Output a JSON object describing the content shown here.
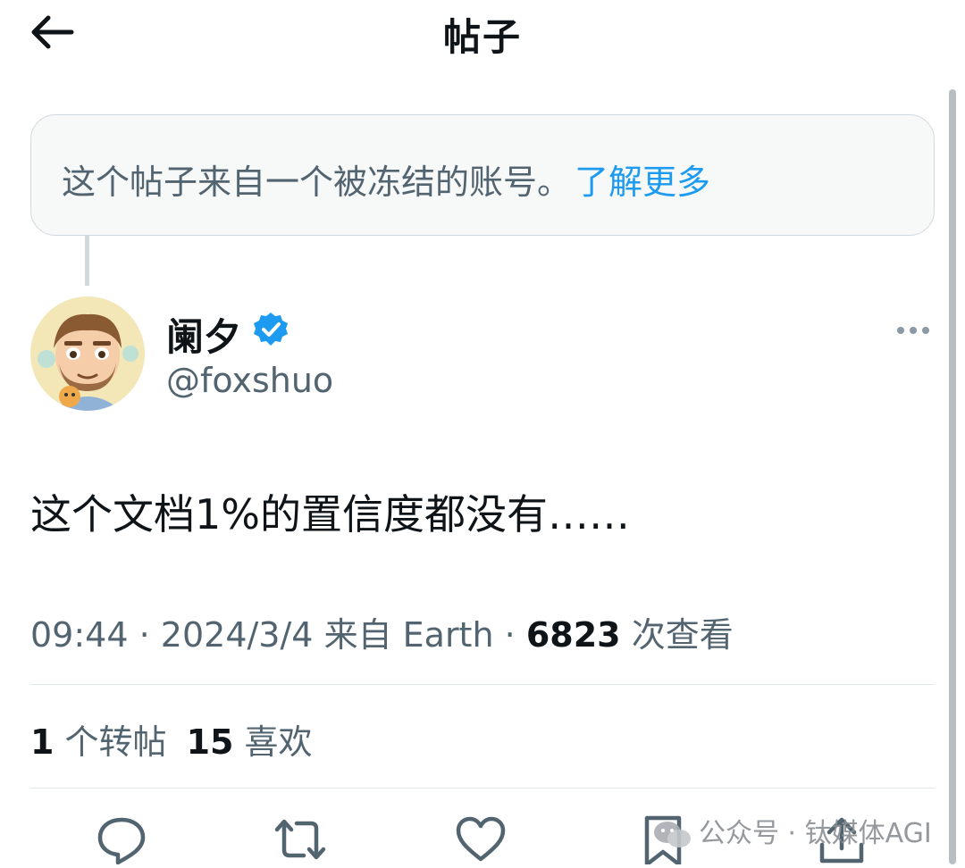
{
  "header": {
    "title": "帖子"
  },
  "notice": {
    "text": "这个帖子来自一个被冻结的账号。",
    "link": "了解更多"
  },
  "author": {
    "name": "阑夕",
    "handle": "@foxshuo",
    "verified": true
  },
  "post": {
    "text": "这个文档1%的置信度都没有……",
    "time": "09:44",
    "date": "2024/3/4",
    "source": "来自 Earth",
    "views": "6823",
    "views_label": "次查看"
  },
  "stats": {
    "reposts": "1",
    "reposts_label": "个转帖",
    "likes": "15",
    "likes_label": "喜欢"
  },
  "actions": [
    "reply-icon",
    "repost-icon",
    "like-icon",
    "bookmark-icon",
    "share-icon"
  ],
  "watermark": {
    "text": "公众号 · 钛媒体AGI"
  },
  "colors": {
    "accent": "#1d9bf0",
    "secondary_text": "#536471",
    "text": "#0f1419"
  }
}
